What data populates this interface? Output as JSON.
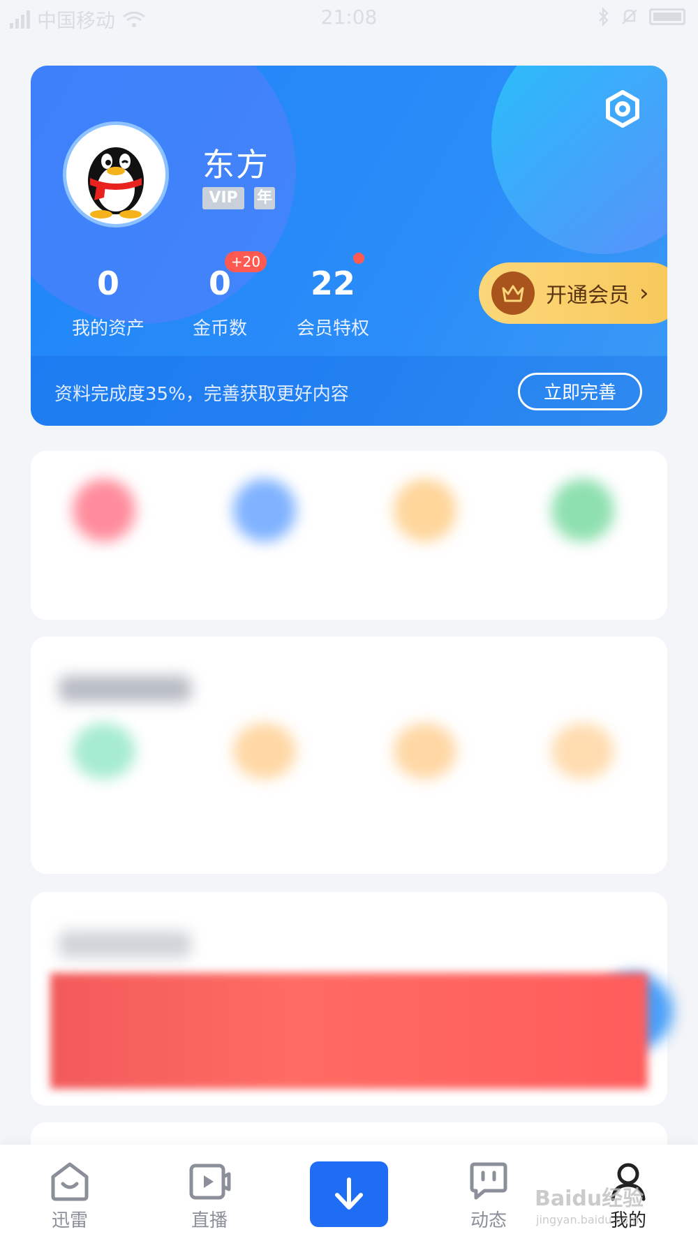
{
  "status_bar": {
    "carrier": "中国移动",
    "time": "21:08"
  },
  "profile": {
    "username": "东方",
    "badges": [
      "VIP",
      "年"
    ],
    "stats": [
      {
        "value": "0",
        "label": "我的资产"
      },
      {
        "value": "0",
        "label": "金币数",
        "badge": "+20"
      },
      {
        "value": "22",
        "label": "会员特权"
      }
    ],
    "vip_button": "开通会员",
    "completion_text": "资料完成度35%，完善获取更好内容",
    "complete_button": "立即完善"
  },
  "bottom_nav": [
    {
      "label": "迅雷",
      "icon": "home-icon"
    },
    {
      "label": "直播",
      "icon": "video-icon"
    },
    {
      "label": "",
      "icon": "download-icon"
    },
    {
      "label": "动态",
      "icon": "chat-icon"
    },
    {
      "label": "我的",
      "icon": "user-icon"
    }
  ],
  "watermark": {
    "text": "Baidu经验",
    "sub": "jingyan.baidu.com"
  },
  "colors": {
    "card_blue": "#1f85f8",
    "vip_gold": "#f7c85a",
    "accent_red": "#ff5a52",
    "nav_blue": "#1f6df5"
  }
}
